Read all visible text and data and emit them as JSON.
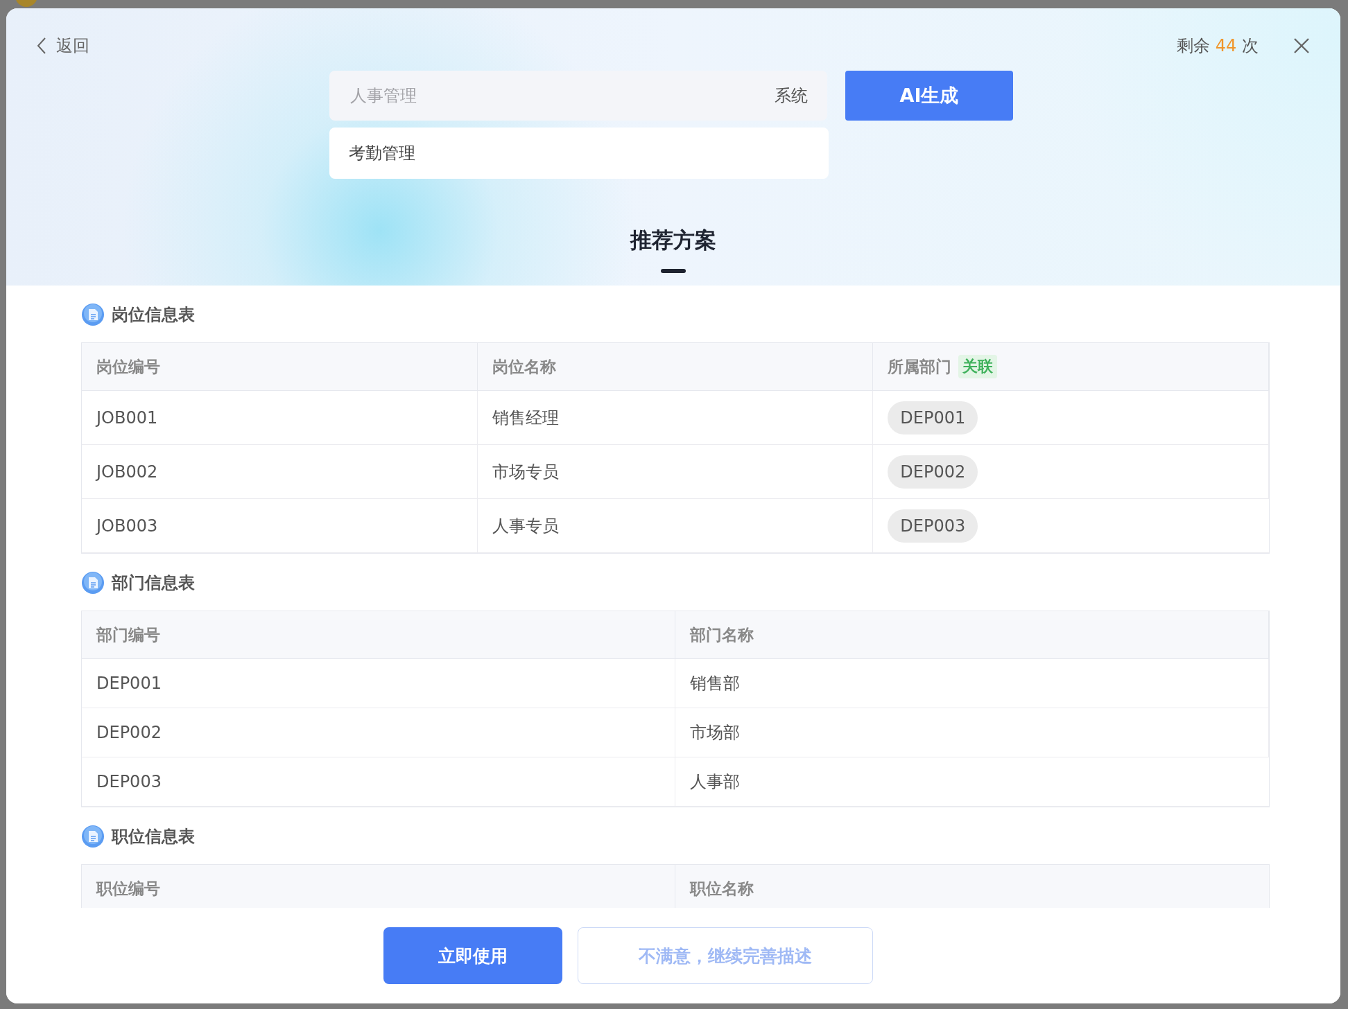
{
  "back": "返回",
  "quota": {
    "prefix": "剩余",
    "count": "44",
    "suffix": "次"
  },
  "search": {
    "placeholder": "人事管理",
    "suffix": "系统"
  },
  "suggestions": [
    "考勤管理"
  ],
  "generate_button": "AI生成",
  "title": "推荐方案",
  "tables": [
    {
      "title": "岗位信息表",
      "columns": [
        {
          "label": "岗位编号"
        },
        {
          "label": "岗位名称"
        },
        {
          "label": "所属部门",
          "tag": "关联"
        }
      ],
      "rows": [
        [
          {
            "kind": "text",
            "text": "JOB001"
          },
          {
            "kind": "text",
            "text": "销售经理"
          },
          {
            "kind": "chip",
            "text": "DEP001"
          }
        ],
        [
          {
            "kind": "text",
            "text": "JOB002"
          },
          {
            "kind": "text",
            "text": "市场专员"
          },
          {
            "kind": "chip",
            "text": "DEP002"
          }
        ],
        [
          {
            "kind": "text",
            "text": "JOB003"
          },
          {
            "kind": "text",
            "text": "人事专员"
          },
          {
            "kind": "chip",
            "text": "DEP003"
          }
        ]
      ]
    },
    {
      "title": "部门信息表",
      "columns": [
        {
          "label": "部门编号"
        },
        {
          "label": "部门名称"
        }
      ],
      "rows": [
        [
          {
            "kind": "text",
            "text": "DEP001"
          },
          {
            "kind": "text",
            "text": "销售部"
          }
        ],
        [
          {
            "kind": "text",
            "text": "DEP002"
          },
          {
            "kind": "text",
            "text": "市场部"
          }
        ],
        [
          {
            "kind": "text",
            "text": "DEP003"
          },
          {
            "kind": "text",
            "text": "人事部"
          }
        ]
      ]
    },
    {
      "title": "职位信息表",
      "columns": [
        {
          "label": "职位编号"
        },
        {
          "label": "职位名称"
        }
      ]
    }
  ],
  "actions": {
    "primary": "立即使用",
    "secondary": "不满意，继续完善描述"
  }
}
